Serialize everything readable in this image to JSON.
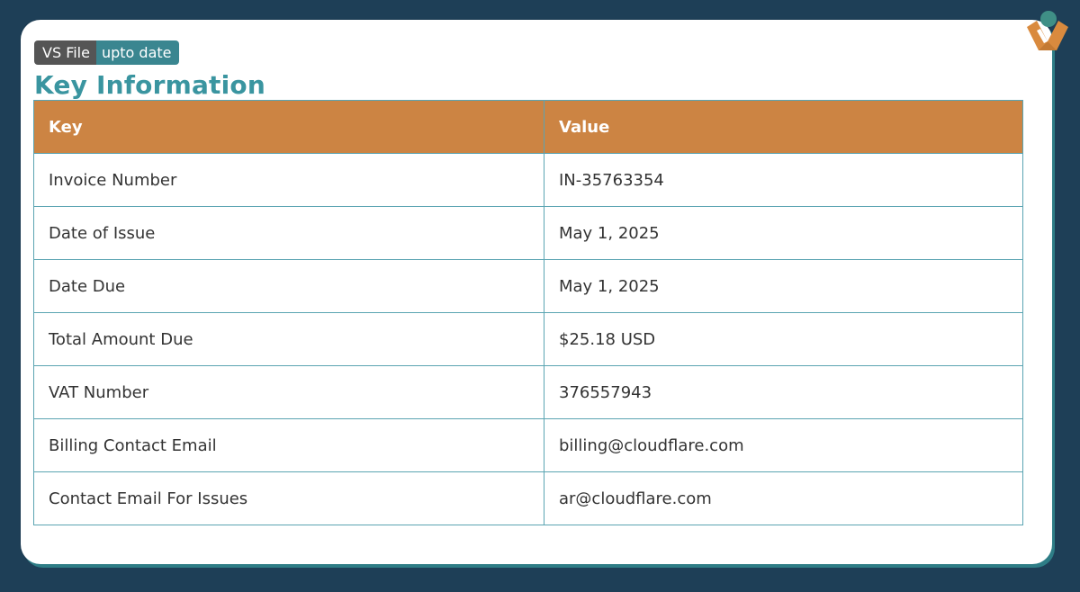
{
  "badge": {
    "left_label": "VS File",
    "right_label": "upto date"
  },
  "heading": "Key Information",
  "table": {
    "headers": [
      "Key",
      "Value"
    ],
    "rows": [
      {
        "key": "Invoice Number",
        "value": "IN-35763354"
      },
      {
        "key": "Date of Issue",
        "value": "May 1, 2025"
      },
      {
        "key": "Date Due",
        "value": "May 1, 2025"
      },
      {
        "key": "Total Amount Due",
        "value": "$25.18 USD"
      },
      {
        "key": "VAT Number",
        "value": "376557943"
      },
      {
        "key": "Billing Contact Email",
        "value": "billing@cloudflare.com"
      },
      {
        "key": "Contact Email For Issues",
        "value": "ar@cloudflare.com"
      }
    ]
  },
  "colors": {
    "background": "#1e3f57",
    "heading": "#3a95a0",
    "table_header": "#cc8443",
    "table_border": "#5aa4b2",
    "badge_left": "#555555",
    "badge_right": "#3a8690"
  },
  "icons": {
    "logo": "orange-teal-logo-icon"
  }
}
